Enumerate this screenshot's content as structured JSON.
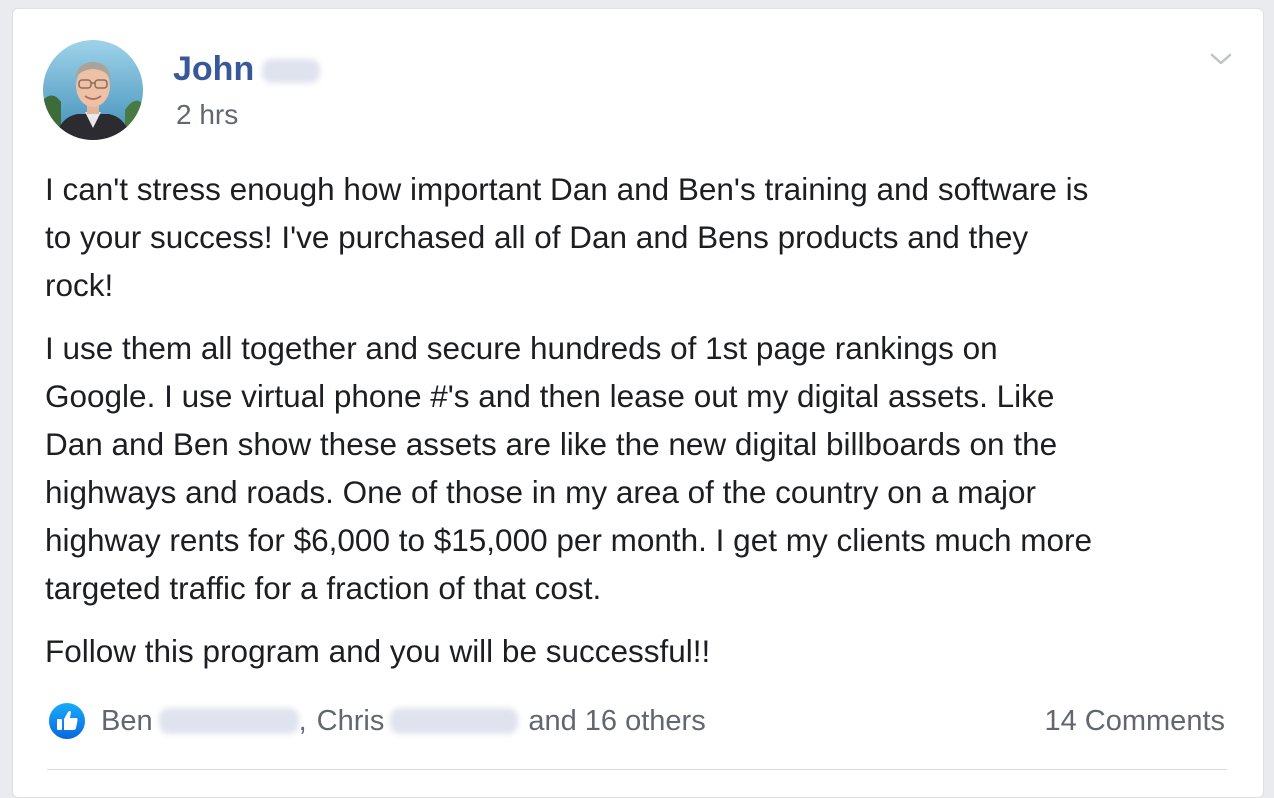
{
  "post": {
    "author_first_name": "John",
    "timestamp": "2 hrs",
    "paragraphs": [
      {
        "lines": [
          "I can't stress enough how important Dan and Ben's training and software is",
          "to your success! I've purchased all of Dan and Bens products and they",
          "rock!"
        ]
      },
      {
        "lines": [
          "I use them all together and secure hundreds of 1st page rankings on",
          "Google. I use virtual phone #'s and then lease out my digital assets. Like",
          "Dan and Ben show these assets are like the new digital billboards on the",
          "highways and roads. One of those in my area of the country on a major",
          "highway rents for $6,000 to $15,000 per month. I get my clients much more",
          "targeted traffic for a fraction of that cost."
        ]
      },
      {
        "lines": [
          "Follow this program and you will be successful!!"
        ]
      }
    ],
    "reactions": {
      "first_name_1": "Ben",
      "separator": ",",
      "first_name_2": "Chris",
      "others_text": "and 16 others"
    },
    "comments_text": "14 Comments"
  },
  "icons": {
    "like": "like-icon",
    "options": "chevron-down-icon",
    "avatar": "avatar"
  },
  "colors": {
    "author_name": "#385898",
    "secondary_text": "#606770",
    "body_text": "#1c1e21",
    "like_badge": "#1877f2",
    "card_background": "#ffffff",
    "page_background": "#e9ebee"
  }
}
